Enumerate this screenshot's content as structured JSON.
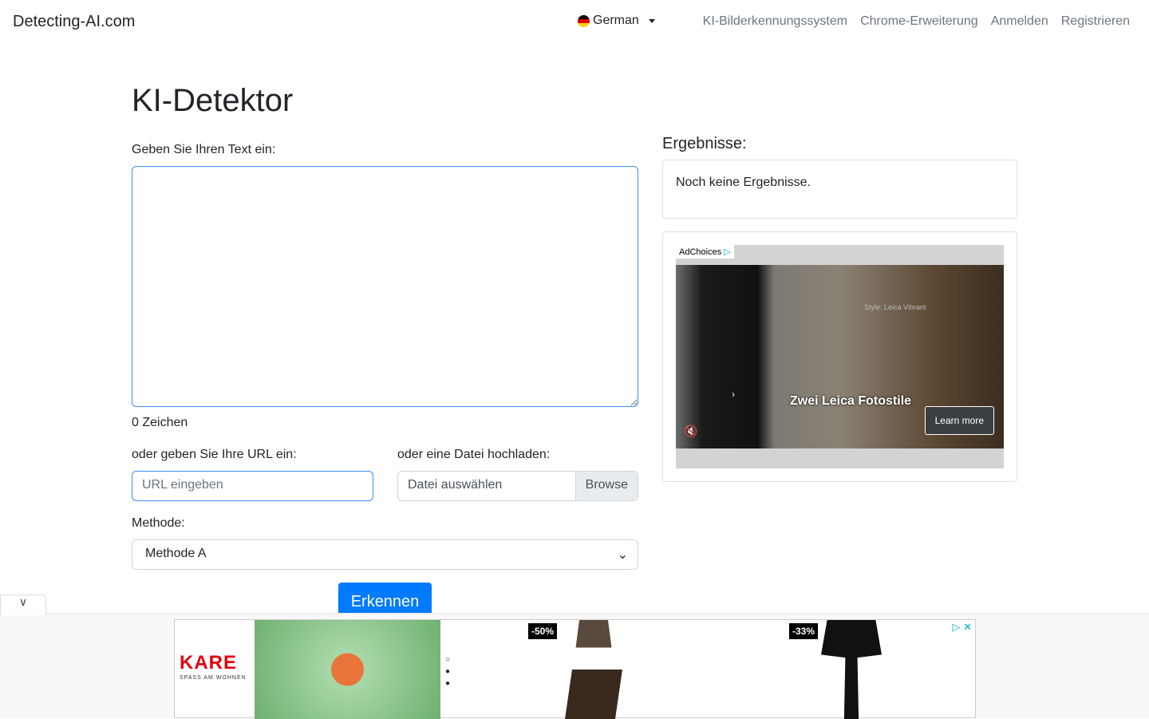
{
  "nav": {
    "brand": "Detecting-AI.com",
    "language": "German",
    "links": [
      "KI-Bilderkennungssystem",
      "Chrome-Erweiterung",
      "Anmelden",
      "Registrieren"
    ]
  },
  "main": {
    "title": "KI-Detektor",
    "text_label": "Geben Sie Ihren Text ein:",
    "char_count": "0 Zeichen",
    "url_label": "oder geben Sie Ihre URL ein:",
    "url_placeholder": "URL eingeben",
    "file_label": "oder eine Datei hochladen:",
    "file_placeholder": "Datei auswählen",
    "browse": "Browse",
    "method_label": "Methode:",
    "method_value": "Methode A",
    "submit": "Erkennen"
  },
  "results": {
    "title": "Ergebnisse:",
    "empty": "Noch keine Ergebnisse."
  },
  "ad": {
    "adchoices": "AdChoices",
    "style": "Style: Leica Vibrant",
    "headline": "Zwei Leica Fotostile",
    "cta": "Learn more"
  },
  "bottom_ad": {
    "brand": "KARE",
    "tagline": "SPASS AM WOHNEN",
    "discount1": "-50%",
    "discount2": "-33%"
  }
}
